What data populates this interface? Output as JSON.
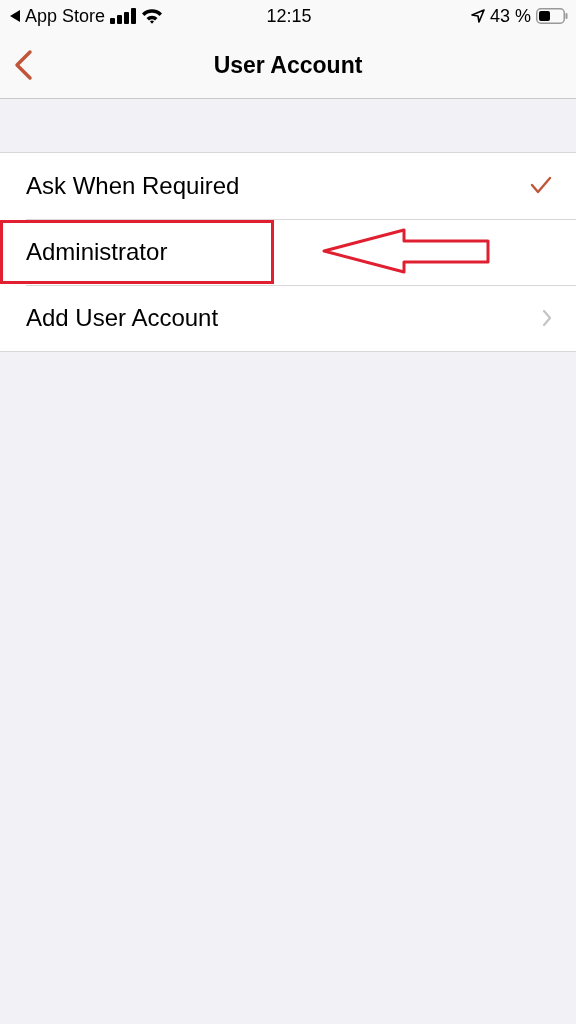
{
  "status_bar": {
    "back_app": "App Store",
    "time": "12:15",
    "battery": "43 %"
  },
  "nav_bar": {
    "title": "User Account"
  },
  "rows": [
    {
      "kind": "option",
      "label": "Ask When Required",
      "selected": true,
      "highlighted": false
    },
    {
      "kind": "option",
      "label": "Administrator",
      "selected": false,
      "highlighted": true
    },
    {
      "kind": "link",
      "label": "Add User Account",
      "highlighted": false
    }
  ]
}
